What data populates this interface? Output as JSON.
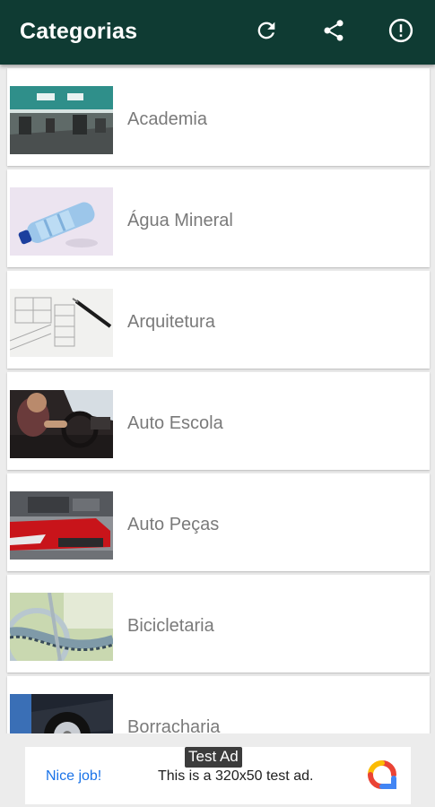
{
  "appbar": {
    "title": "Categorias",
    "background": "#0f3b33",
    "actions": [
      {
        "icon": "refresh-icon"
      },
      {
        "icon": "share-icon"
      },
      {
        "icon": "info-icon"
      }
    ]
  },
  "categories": [
    {
      "label": "Academia"
    },
    {
      "label": "Água Mineral"
    },
    {
      "label": "Arquitetura"
    },
    {
      "label": "Auto Escola"
    },
    {
      "label": "Auto Peças"
    },
    {
      "label": "Bicicletaria"
    },
    {
      "label": "Borracharia"
    }
  ],
  "ad": {
    "badge": "Test Ad",
    "cta": "Nice job!",
    "text": "This is a 320x50 test ad.",
    "cta_color": "#1a73e8"
  }
}
